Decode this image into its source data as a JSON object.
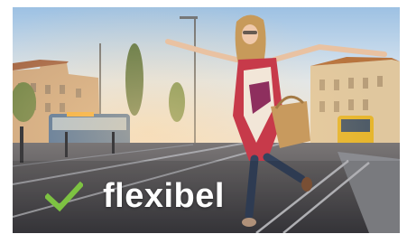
{
  "photo": {
    "subject": "woman-balancing-on-tram-rail-icon"
  },
  "caption": {
    "icon": "green-checkmark-icon",
    "icon_color": "#7dc242",
    "text": "flexibel"
  }
}
